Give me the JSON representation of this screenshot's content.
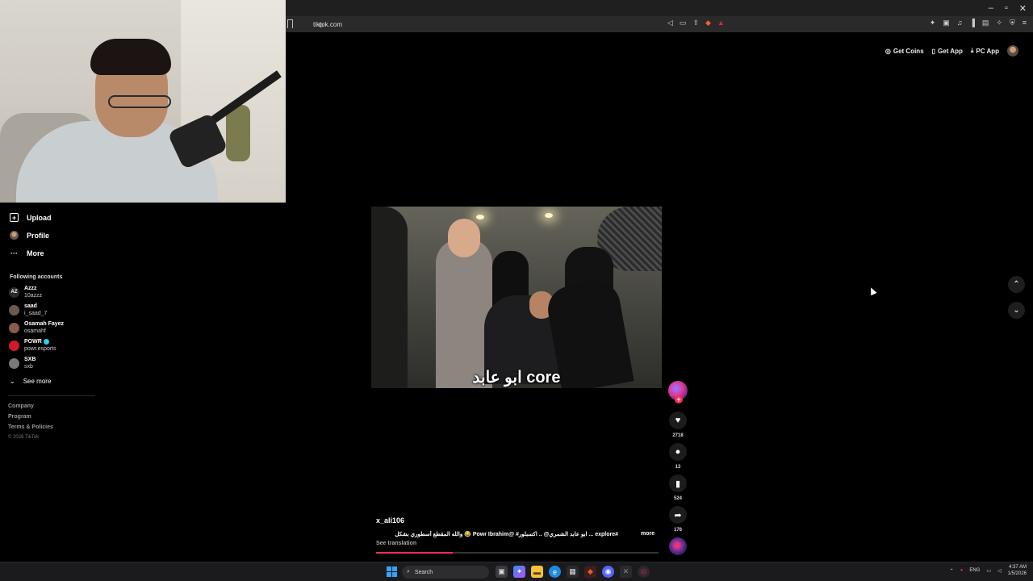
{
  "browser": {
    "url": "tiktok.com",
    "window_controls": [
      "–",
      "▫",
      "✕"
    ]
  },
  "header": {
    "get_coins": "Get Coins",
    "get_app": "Get App",
    "pc_app": "PC App"
  },
  "sidebar": {
    "upload": "Upload",
    "profile": "Profile",
    "more": "More",
    "following_title": "Following accounts",
    "accounts": [
      {
        "name": "Azzz",
        "handle": "10azzz",
        "color": "#2a2a2a",
        "verified": false
      },
      {
        "name": "saad",
        "handle": "i_saad_7",
        "color": "#6b5a4e",
        "verified": false
      },
      {
        "name": "Osamah Fayez",
        "handle": "osamahf",
        "color": "#8a5a4a",
        "verified": false
      },
      {
        "name": "POWR",
        "handle": "powr.esports",
        "color": "#d01a2a",
        "verified": true
      },
      {
        "name": "SXB",
        "handle": "sxb",
        "color": "#7a7a7a",
        "verified": false
      }
    ],
    "see_more": "See more",
    "footer": [
      "Company",
      "Program",
      "Terms & Policies"
    ],
    "copyright": "© 2026 TikTok"
  },
  "video": {
    "caption": "ابو عابد core",
    "username": "x_ali106",
    "description": "#explore ... ابو عابد الشمري@ .. اكسبلور# @Powr Ibrahim 😂 والله المقطع أسطوري بشكل",
    "more": "more",
    "see_translation": "See translation",
    "progress": 0.27
  },
  "actions": {
    "likes": "2718",
    "comments": "13",
    "saves": "524",
    "shares": "176"
  },
  "taskbar": {
    "search_placeholder": "Search",
    "language": "ENG",
    "time": "4:37 AM",
    "date": "1/5/2026"
  },
  "colors": {
    "accent": "#fe2c55",
    "background": "#000000"
  }
}
